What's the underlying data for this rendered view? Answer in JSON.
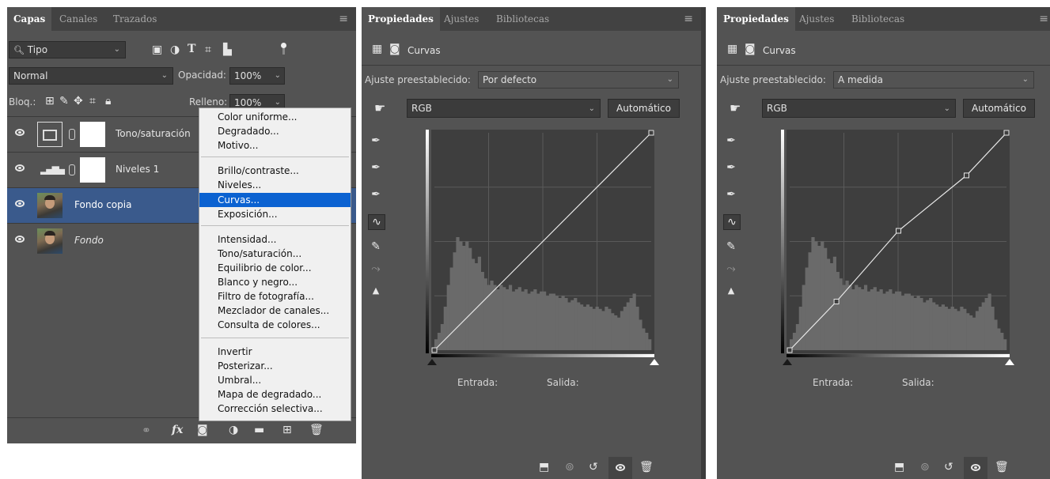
{
  "layers_panel": {
    "tabs": [
      "Capas",
      "Canales",
      "Trazados"
    ],
    "filter_kind": "Tipo",
    "blend_mode": "Normal",
    "opacity_label": "Opacidad:",
    "opacity_value": "100%",
    "lock_label": "Bloq.:",
    "fill_label": "Relleno:",
    "fill_value": "100%",
    "layers": [
      {
        "name": "Tono/saturación",
        "kind": "adjustment-hue-sat",
        "visible": true,
        "selected": false,
        "italic": false
      },
      {
        "name": "Niveles 1",
        "kind": "adjustment-levels",
        "visible": true,
        "selected": false,
        "italic": false
      },
      {
        "name": "Fondo copia",
        "kind": "photo",
        "visible": true,
        "selected": true,
        "italic": false
      },
      {
        "name": "Fondo",
        "kind": "photo",
        "visible": true,
        "selected": false,
        "italic": true
      }
    ],
    "footer_icons": [
      "link-icon",
      "fx-icon",
      "mask-icon",
      "adjustment-icon",
      "group-icon",
      "new-layer-icon",
      "trash-icon"
    ]
  },
  "adjustment_menu": {
    "groups": [
      [
        "Color uniforme...",
        "Degradado...",
        "Motivo..."
      ],
      [
        "Brillo/contraste...",
        "Niveles...",
        "Curvas...",
        "Exposición..."
      ],
      [
        "Intensidad...",
        "Tono/saturación...",
        "Equilibrio de color...",
        "Blanco y negro...",
        "Filtro de fotografía...",
        "Mezclador de canales...",
        "Consulta de colores..."
      ],
      [
        "Invertir",
        "Posterizar...",
        "Umbral...",
        "Mapa de degradado...",
        "Corrección selectiva..."
      ]
    ],
    "highlighted": "Curvas..."
  },
  "properties_panels": [
    {
      "tabs": [
        "Propiedades",
        "Ajustes",
        "Bibliotecas"
      ],
      "section_title": "Curvas",
      "preset_label": "Ajuste preestablecido:",
      "preset_value": "Por defecto",
      "channel": "RGB",
      "auto_button": "Automático",
      "input_label": "Entrada:",
      "output_label": "Salida:",
      "curve_points": [
        [
          0,
          0
        ],
        [
          255,
          255
        ]
      ]
    },
    {
      "tabs": [
        "Propiedades",
        "Ajustes",
        "Bibliotecas"
      ],
      "section_title": "Curvas",
      "preset_label": "Ajuste preestablecido:",
      "preset_value": "A medida",
      "channel": "RGB",
      "auto_button": "Automático",
      "input_label": "Entrada:",
      "output_label": "Salida:",
      "curve_points": [
        [
          0,
          0
        ],
        [
          55,
          57
        ],
        [
          128,
          140
        ],
        [
          208,
          205
        ],
        [
          255,
          255
        ]
      ]
    }
  ],
  "histogram": [
    0.05,
    0.08,
    0.12,
    0.2,
    0.3,
    0.38,
    0.45,
    0.52,
    0.5,
    0.48,
    0.5,
    0.47,
    0.42,
    0.4,
    0.43,
    0.36,
    0.33,
    0.3,
    0.32,
    0.3,
    0.28,
    0.3,
    0.29,
    0.28,
    0.3,
    0.27,
    0.28,
    0.29,
    0.27,
    0.28,
    0.26,
    0.27,
    0.28,
    0.26,
    0.27,
    0.27,
    0.25,
    0.26,
    0.26,
    0.25,
    0.24,
    0.25,
    0.24,
    0.22,
    0.23,
    0.24,
    0.22,
    0.21,
    0.2,
    0.21,
    0.2,
    0.19,
    0.2,
    0.19,
    0.18,
    0.2,
    0.19,
    0.17,
    0.16,
    0.15,
    0.18,
    0.2,
    0.22,
    0.24,
    0.26,
    0.2,
    0.14,
    0.1,
    0.08,
    0.05
  ],
  "colors": {
    "panel": "#535353",
    "tabbar": "#424242",
    "selection": "#0b62d1",
    "layer_selected": "#3a5a8c"
  }
}
